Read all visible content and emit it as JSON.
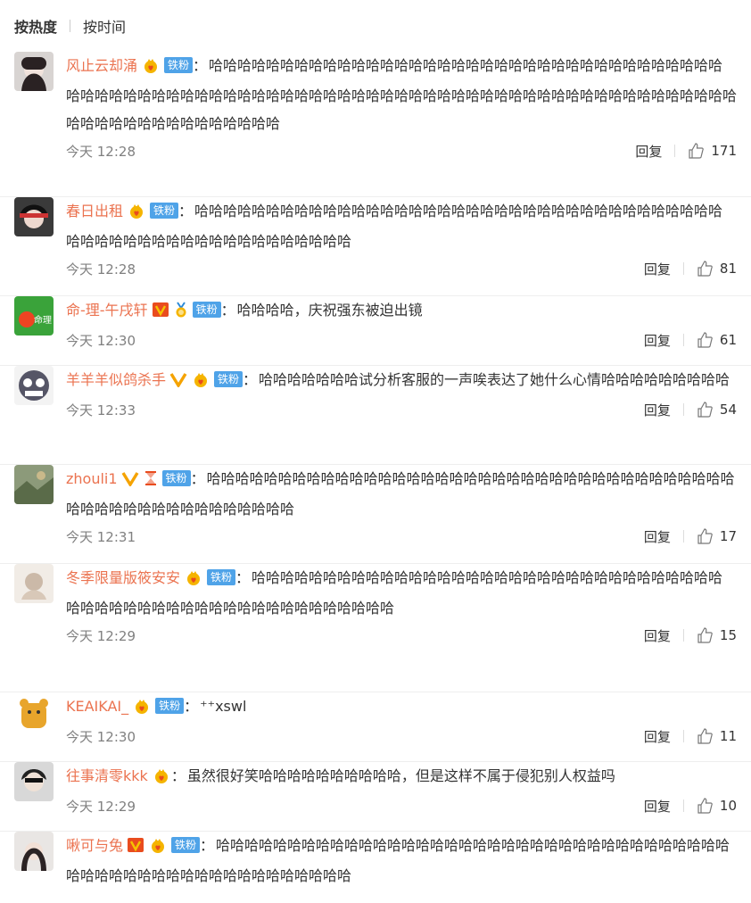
{
  "sort": {
    "by_heat": "按热度",
    "by_time": "按时间"
  },
  "colors": {
    "username": "#eb7350",
    "fan_badge": "#4fa3e8",
    "vip_red": "#e94c1e",
    "vip_gold": "#f5b400"
  },
  "reply_label": "回复",
  "fan_label": "铁粉",
  "comments": [
    {
      "user": "风止云却涌",
      "badges": [
        "crown-heart-icon"
      ],
      "fan": true,
      "text": "哈哈哈哈哈哈哈哈哈哈哈哈哈哈哈哈哈哈哈哈哈哈哈哈哈哈哈哈哈哈哈哈哈哈哈哈哈哈哈哈哈哈哈哈哈哈哈哈哈哈哈哈哈哈哈哈哈哈哈哈哈哈哈哈哈哈哈哈哈哈哈哈哈哈哈哈哈哈哈哈哈哈哈哈哈哈哈哈哈哈哈哈哈哈哈哈哈哈",
      "time": "今天 12:28",
      "likes": "171"
    },
    {
      "user": "春日出租",
      "badges": [
        "crown-heart-icon"
      ],
      "fan": true,
      "text": "哈哈哈哈哈哈哈哈哈哈哈哈哈哈哈哈哈哈哈哈哈哈哈哈哈哈哈哈哈哈哈哈哈哈哈哈哈哈哈哈哈哈哈哈哈哈哈哈哈哈哈哈哈哈哈哈哈",
      "time": "今天 12:28",
      "likes": "81"
    },
    {
      "user": "命-理-午戌轩",
      "badges": [
        "vip-red-icon",
        "medal-icon"
      ],
      "fan": true,
      "text": "哈哈哈哈，庆祝强东被迫出镜",
      "time": "今天 12:30",
      "likes": "61"
    },
    {
      "user": "羊羊羊似鸽杀手",
      "badges": [
        "verified-v-icon",
        "crown-heart-icon"
      ],
      "fan": true,
      "text": "哈哈哈哈哈哈哈试分析客服的一声唉表达了她什么心情哈哈哈哈哈哈哈哈哈",
      "time": "今天 12:33",
      "likes": "54"
    },
    {
      "user": "zhouli1",
      "badges": [
        "verified-v-icon",
        "hourglass-icon"
      ],
      "fan": true,
      "text": "哈哈哈哈哈哈哈哈哈哈哈哈哈哈哈哈哈哈哈哈哈哈哈哈哈哈哈哈哈哈哈哈哈哈哈哈哈哈哈哈哈哈哈哈哈哈哈哈哈哈哈哈哈",
      "time": "今天 12:31",
      "likes": "17"
    },
    {
      "user": "冬季限量版筱安安",
      "badges": [
        "crown-heart-icon"
      ],
      "fan": true,
      "text": "哈哈哈哈哈哈哈哈哈哈哈哈哈哈哈哈哈哈哈哈哈哈哈哈哈哈哈哈哈哈哈哈哈哈哈哈哈哈哈哈哈哈哈哈哈哈哈哈哈哈哈哈哈哈哈哈",
      "time": "今天 12:29",
      "likes": "15"
    },
    {
      "user": "KEAIKAI_",
      "badges": [
        "crown-heart-icon"
      ],
      "fan": true,
      "text": "⁺⁺xswl",
      "time": "今天 12:30",
      "likes": "11"
    },
    {
      "user": "往事清零kkk",
      "badges": [
        "crown-heart-icon"
      ],
      "fan": false,
      "text": "虽然很好笑哈哈哈哈哈哈哈哈哈哈，但是这样不属于侵犯别人权益吗",
      "time": "今天 12:29",
      "likes": "10"
    },
    {
      "user": "啾可与兔",
      "badges": [
        "vip-red-icon",
        "crown-heart-icon"
      ],
      "fan": true,
      "text": "哈哈哈哈哈哈哈哈哈哈哈哈哈哈哈哈哈哈哈哈哈哈哈哈哈哈哈哈哈哈哈哈哈哈哈哈哈哈哈哈哈哈哈哈哈哈哈哈哈哈哈哈哈哈哈哈",
      "time": "",
      "likes": ""
    }
  ]
}
